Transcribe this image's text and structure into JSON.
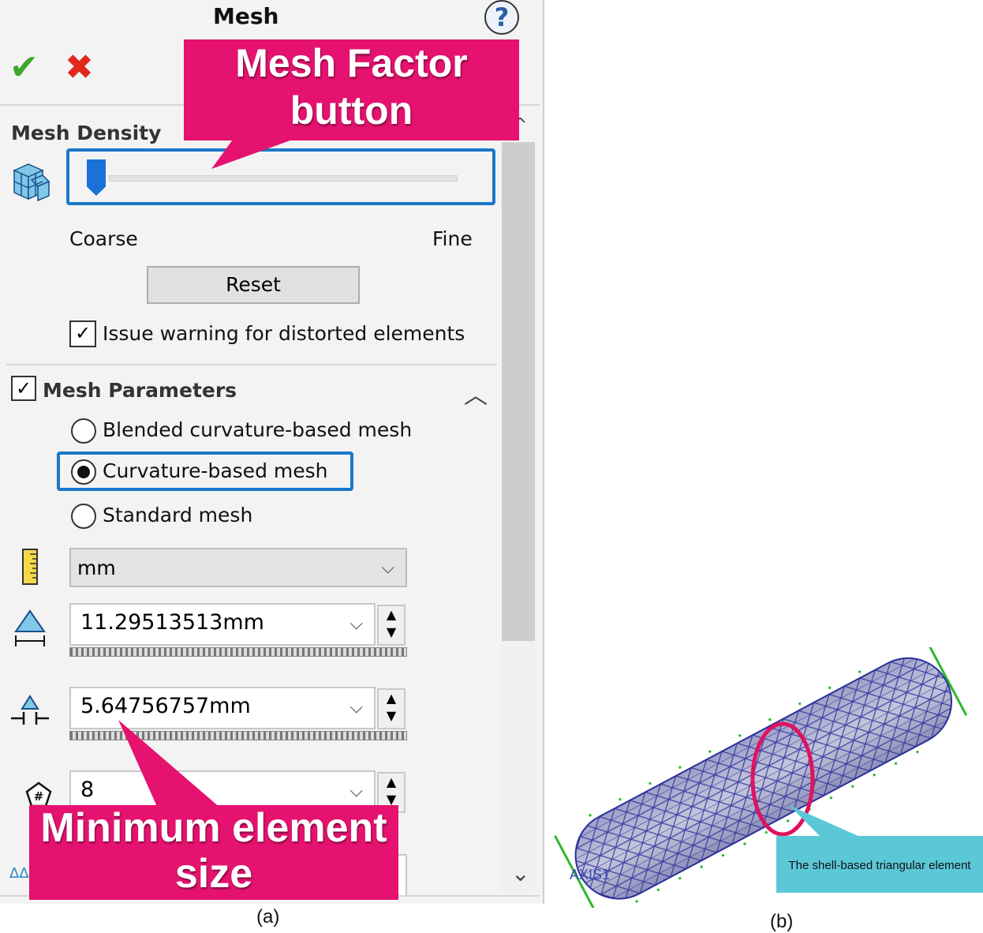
{
  "panel": {
    "title": "Mesh",
    "help_icon": "?",
    "ok_icon": "✔",
    "cancel_icon": "✖",
    "mesh_density": {
      "header": "Mesh Density",
      "slider_level": 0.05,
      "coarse_label": "Coarse",
      "fine_label": "Fine",
      "reset_label": "Reset",
      "warning_checkbox_label": "Issue warning for distorted elements",
      "warning_checked": true
    },
    "mesh_parameters": {
      "header": "Mesh Parameters",
      "checked": true,
      "options": [
        "Blended curvature-based mesh",
        "Curvature-based mesh",
        "Standard mesh"
      ],
      "selected": "Curvature-based mesh",
      "unit": "mm",
      "max_element_size": "11.29513513mm",
      "min_element_size": "5.64756757mm",
      "min_elements_in_circle": "8"
    }
  },
  "annotations": {
    "mesh_factor": "Mesh Factor button",
    "min_element": "Minimum element size",
    "shell_element": "The shell-based triangular element",
    "model_label": "AXIS1"
  },
  "captions": {
    "a": "(a)",
    "b": "(b)"
  },
  "colors": {
    "accent": "#1a78c8",
    "callout": "#e5126f",
    "callout2": "#5bc8d8",
    "mesh": "#2b2f9a",
    "fixture": "#2eb82e"
  }
}
